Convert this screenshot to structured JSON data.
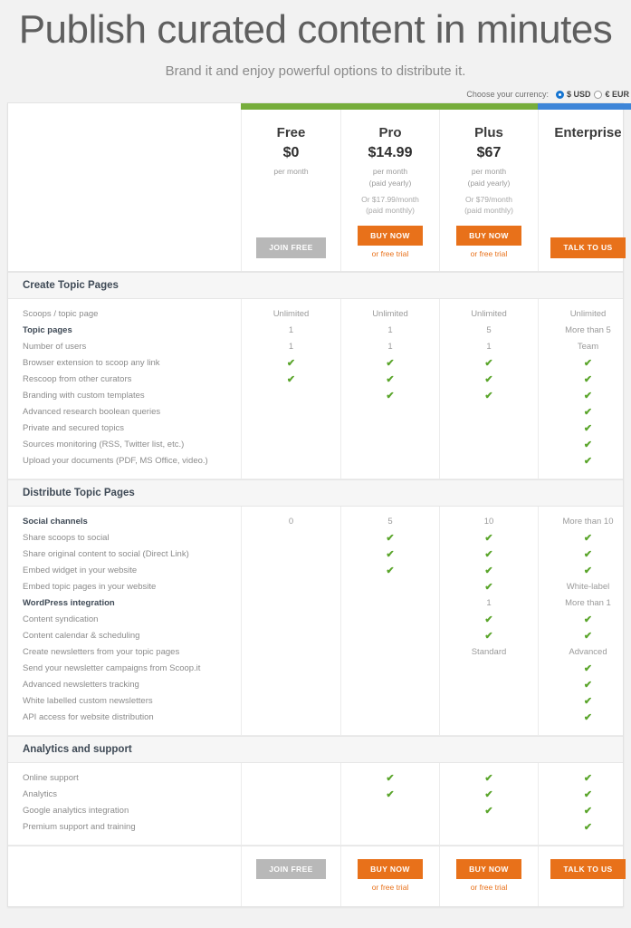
{
  "hero": {
    "title": "Publish curated content in minutes",
    "subtitle": "Brand it and enjoy powerful options to distribute it."
  },
  "currency": {
    "label": "Choose your currency:",
    "options": [
      {
        "label": "$ USD",
        "selected": true
      },
      {
        "label": "€ EUR",
        "selected": false
      }
    ]
  },
  "plans": [
    {
      "name": "Free",
      "price": "$0",
      "note": "per month",
      "note_line2": "",
      "note2": "",
      "note2_line2": "",
      "cta_label": "JOIN FREE",
      "cta_style": "gray",
      "free_trial": "",
      "accent": "#76ad3b"
    },
    {
      "name": "Pro",
      "price": "$14.99",
      "note": "per month",
      "note_line2": "(paid yearly)",
      "note2": "Or $17.99/month",
      "note2_line2": "(paid monthly)",
      "cta_label": "BUY NOW",
      "cta_style": "orange",
      "free_trial": "or free trial",
      "accent": "#76ad3b"
    },
    {
      "name": "Plus",
      "price": "$67",
      "note": "per month",
      "note_line2": "(paid yearly)",
      "note2": "Or $79/month",
      "note2_line2": "(paid monthly)",
      "cta_label": "BUY NOW",
      "cta_style": "orange",
      "free_trial": "or free trial",
      "accent": "#76ad3b"
    },
    {
      "name": "Enterprise",
      "price": "",
      "note": "",
      "note_line2": "",
      "note2": "",
      "note2_line2": "",
      "cta_label": "TALK TO US",
      "cta_style": "orange",
      "free_trial": "",
      "accent": "#3d85d8"
    }
  ],
  "sections": [
    {
      "title": "Create Topic Pages",
      "rows": [
        {
          "label": "Scoops / topic page",
          "bold": false,
          "values": [
            "Unlimited",
            "Unlimited",
            "Unlimited",
            "Unlimited"
          ]
        },
        {
          "label": "Topic pages",
          "bold": true,
          "values": [
            "1",
            "1",
            "5",
            "More than 5"
          ]
        },
        {
          "label": "Number of users",
          "bold": false,
          "values": [
            "1",
            "1",
            "1",
            "Team"
          ]
        },
        {
          "label": "Browser extension to scoop any link",
          "bold": false,
          "values": [
            "check",
            "check",
            "check",
            "check"
          ]
        },
        {
          "label": "Rescoop from other curators",
          "bold": false,
          "values": [
            "check",
            "check",
            "check",
            "check"
          ]
        },
        {
          "label": "Branding with custom templates",
          "bold": false,
          "values": [
            "",
            "check",
            "check",
            "check"
          ]
        },
        {
          "label": "Advanced research boolean queries",
          "bold": false,
          "values": [
            "",
            "",
            "",
            "check"
          ]
        },
        {
          "label": "Private and secured topics",
          "bold": false,
          "values": [
            "",
            "",
            "",
            "check"
          ]
        },
        {
          "label": "Sources monitoring (RSS, Twitter list, etc.)",
          "bold": false,
          "values": [
            "",
            "",
            "",
            "check"
          ]
        },
        {
          "label": "Upload your documents (PDF, MS Office, video.)",
          "bold": false,
          "values": [
            "",
            "",
            "",
            "check"
          ]
        }
      ]
    },
    {
      "title": "Distribute Topic Pages",
      "rows": [
        {
          "label": "Social channels",
          "bold": true,
          "values": [
            "0",
            "5",
            "10",
            "More than 10"
          ]
        },
        {
          "label": "Share scoops to social",
          "bold": false,
          "values": [
            "",
            "check",
            "check",
            "check"
          ]
        },
        {
          "label": "Share original content to social (Direct Link)",
          "bold": false,
          "values": [
            "",
            "check",
            "check",
            "check"
          ]
        },
        {
          "label": "Embed widget in your website",
          "bold": false,
          "values": [
            "",
            "check",
            "check",
            "check"
          ]
        },
        {
          "label": "Embed topic pages in your website",
          "bold": false,
          "values": [
            "",
            "",
            "check",
            "White-label"
          ]
        },
        {
          "label": "WordPress integration",
          "bold": true,
          "values": [
            "",
            "",
            "1",
            "More than 1"
          ]
        },
        {
          "label": "Content syndication",
          "bold": false,
          "values": [
            "",
            "",
            "check",
            "check"
          ]
        },
        {
          "label": "Content calendar & scheduling",
          "bold": false,
          "values": [
            "",
            "",
            "check",
            "check"
          ]
        },
        {
          "label": "Create newsletters from your topic pages",
          "bold": false,
          "values": [
            "",
            "",
            "Standard",
            "Advanced"
          ]
        },
        {
          "label": "Send your newsletter campaigns from Scoop.it",
          "bold": false,
          "values": [
            "",
            "",
            "",
            "check"
          ]
        },
        {
          "label": "Advanced newsletters tracking",
          "bold": false,
          "values": [
            "",
            "",
            "",
            "check"
          ]
        },
        {
          "label": "White labelled custom newsletters",
          "bold": false,
          "values": [
            "",
            "",
            "",
            "check"
          ]
        },
        {
          "label": "API access for website distribution",
          "bold": false,
          "values": [
            "",
            "",
            "",
            "check"
          ]
        }
      ]
    },
    {
      "title": "Analytics and support",
      "rows": [
        {
          "label": "Online support",
          "bold": false,
          "values": [
            "",
            "check",
            "check",
            "check"
          ]
        },
        {
          "label": "Analytics",
          "bold": false,
          "values": [
            "",
            "check",
            "check",
            "check"
          ]
        },
        {
          "label": "Google analytics integration",
          "bold": false,
          "values": [
            "",
            "",
            "check",
            "check"
          ]
        },
        {
          "label": "Premium support and training",
          "bold": false,
          "values": [
            "",
            "",
            "",
            "check"
          ]
        }
      ]
    }
  ],
  "colors": {
    "orange": "#e8711a",
    "gray_button": "#b8b8b8",
    "green_accent": "#76ad3b",
    "blue_accent": "#3d85d8",
    "check_green": "#5aa52b"
  }
}
